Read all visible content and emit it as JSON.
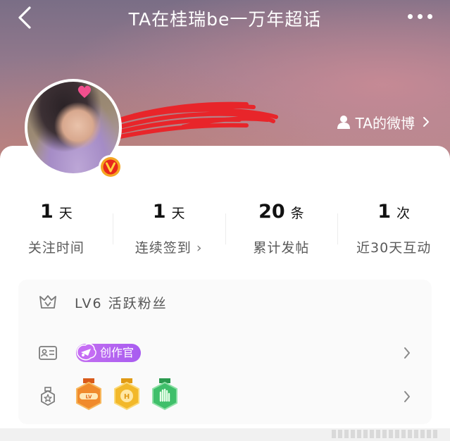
{
  "header": {
    "title": "TA在桂瑞be一万年超话"
  },
  "profile": {
    "weibo_link_label": "TA的微博"
  },
  "stats": [
    {
      "number": "1",
      "unit": "天",
      "label": "关注时间",
      "has_arrow": false
    },
    {
      "number": "1",
      "unit": "天",
      "label": "连续签到",
      "has_arrow": true
    },
    {
      "number": "20",
      "unit": "条",
      "label": "累计发帖",
      "has_arrow": false
    },
    {
      "number": "1",
      "unit": "次",
      "label": "近30天互动",
      "has_arrow": false
    }
  ],
  "details": {
    "level_text": "LV6  活跃粉丝",
    "creator_badge_label": "创作官",
    "medals": [
      {
        "icon": "lv-medal-icon",
        "color": "#f08a2c"
      },
      {
        "icon": "hi-medal-icon",
        "color": "#f2b82a"
      },
      {
        "icon": "hand-medal-icon",
        "color": "#3fbf6a"
      }
    ]
  },
  "colors": {
    "accent_purple": "#b066f0",
    "badge_orange": "#f07a1c"
  },
  "icons": {
    "back": "back-arrow-icon",
    "more": "more-dots-icon",
    "person": "person-icon",
    "verified": "verified-v-icon",
    "level": "level-crown-icon",
    "id_card": "id-card-icon",
    "medal": "medal-icon"
  }
}
